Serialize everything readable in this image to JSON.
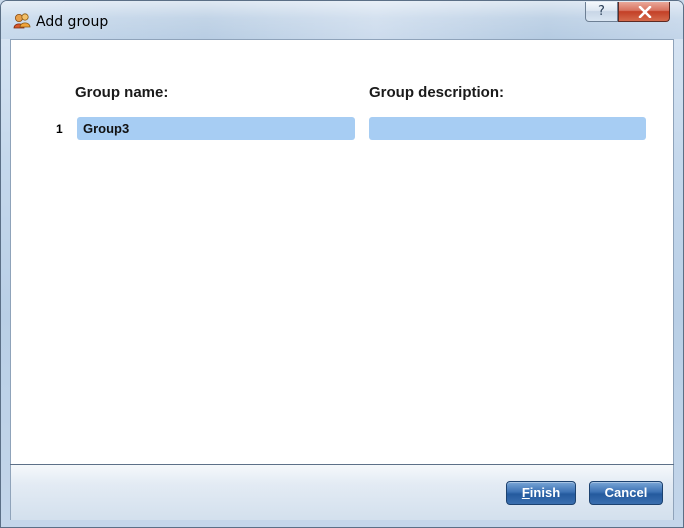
{
  "window": {
    "title": "Add group",
    "help_glyph": "?",
    "icon": "group-add-icon"
  },
  "form": {
    "headers": {
      "name": "Group name:",
      "description": "Group description:"
    },
    "rows": [
      {
        "number": "1",
        "name_value": "Group3",
        "description_value": ""
      }
    ]
  },
  "footer": {
    "finish_mnemonic": "F",
    "finish_rest": "inish",
    "cancel_label": "Cancel"
  },
  "colors": {
    "field_background": "#a7cdf3",
    "button_blue": "#2d63a6",
    "close_red": "#c33f26"
  }
}
